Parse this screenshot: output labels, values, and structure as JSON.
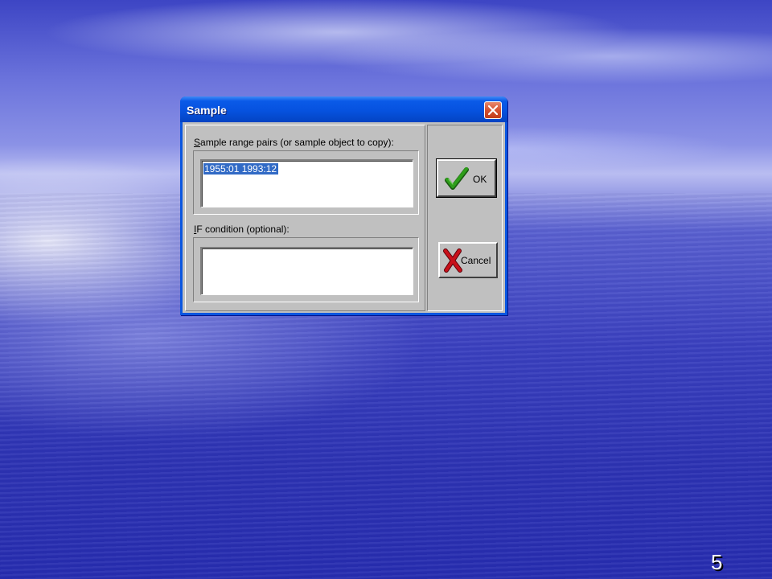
{
  "dialog": {
    "title": "Sample",
    "sample_range_label": "ample range pairs (or sample object to copy):",
    "sample_range_label_mnemonic": "S",
    "sample_range_value": "1955:01 1993:12",
    "if_condition_label": "F condition (optional):",
    "if_condition_label_mnemonic": "I",
    "if_condition_value": "",
    "ok_label": "OK",
    "cancel_label": "Cancel"
  },
  "slide": {
    "number": "5"
  },
  "colors": {
    "title_bar": "#0a56e0",
    "dialog_face": "#c0c0c0",
    "selection": "#316ac5",
    "ok_check": "#2e9e1a",
    "cancel_x": "#c8101a"
  },
  "icons": {
    "close": "close-icon",
    "ok": "checkmark-icon",
    "cancel": "red-x-icon"
  }
}
